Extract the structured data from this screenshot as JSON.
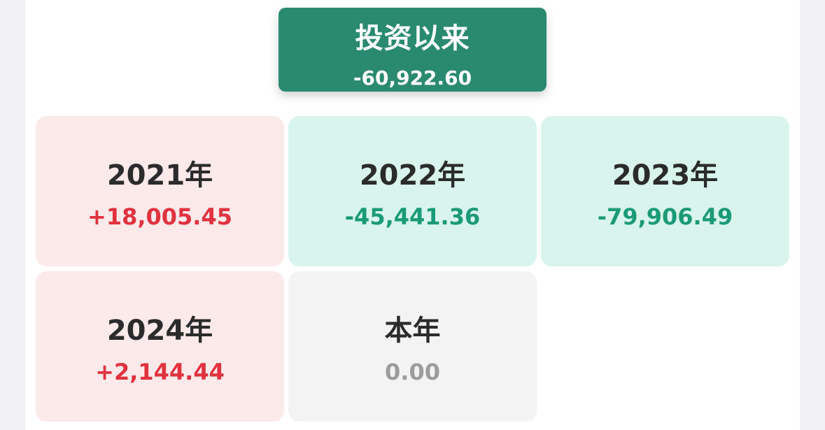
{
  "summary": {
    "title": "投资以来",
    "value": "-60,922.60"
  },
  "years": [
    {
      "label": "2021年",
      "value": "+18,005.45",
      "status": "profit"
    },
    {
      "label": "2022年",
      "value": "-45,441.36",
      "status": "loss"
    },
    {
      "label": "2023年",
      "value": "-79,906.49",
      "status": "loss"
    },
    {
      "label": "2024年",
      "value": "+2,144.44",
      "status": "profit"
    },
    {
      "label": "本年",
      "value": "0.00",
      "status": "neutral"
    }
  ],
  "colors": {
    "summary_bg": "#2a8a70",
    "profit_bg": "#fce9ea",
    "profit_text": "#e0323f",
    "loss_bg": "#d8f4ec",
    "loss_text": "#1a9a76",
    "neutral_bg": "#f3f3f3",
    "neutral_text": "#9c9c9c"
  }
}
